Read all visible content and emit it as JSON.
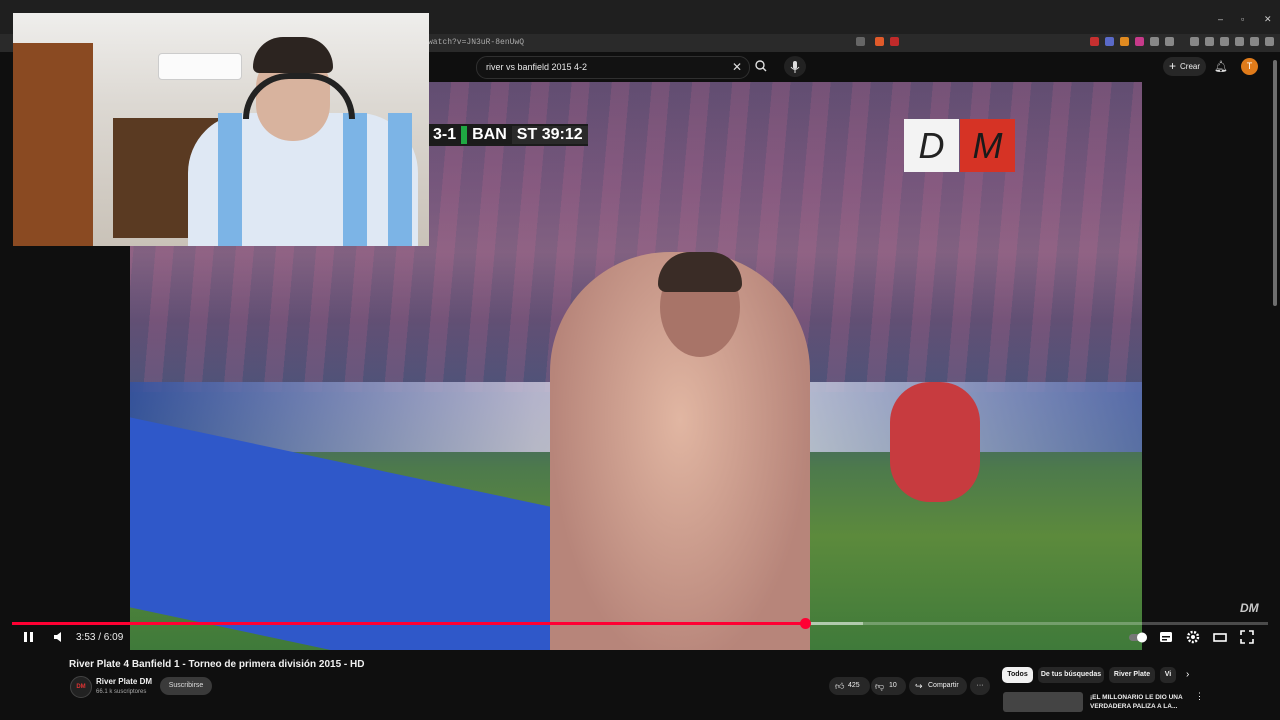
{
  "browser": {
    "url": "watch?v=JN3uR-8enUwQ",
    "window_controls": [
      "–",
      "▫",
      "✕"
    ]
  },
  "youtube_header": {
    "search_query": "river vs banfield 2015 4-2",
    "create_label": "Crear",
    "avatar_letter": "T"
  },
  "video": {
    "scoreboard": {
      "home_score": "3-1",
      "away_team": "BAN",
      "clock": "ST 39:12"
    },
    "logo_letters": [
      "D",
      "M"
    ],
    "watermark": "DM"
  },
  "player_controls": {
    "current_time": "3:53",
    "duration": "6:09",
    "time_display": "3:53 / 6:09",
    "progress_fraction": 0.6314,
    "buffered_fraction": 0.6775
  },
  "video_info": {
    "title": "River Plate 4 Banfield 1 - Torneo de primera división 2015 - HD",
    "channel_name": "River Plate DM",
    "subscribers": "66.1 k suscriptores",
    "subscribe_label": "Suscribirse",
    "likes": "425",
    "dislikes": "10",
    "share_label": "Compartir",
    "more_label": "···"
  },
  "related": {
    "chips": [
      "Todos",
      "De tus búsquedas",
      "River Plate",
      "Vi"
    ],
    "first_video_title": "¡EL MILLONARIO LE DIO UNA VERDADERA PALIZA A LA..."
  },
  "colors": {
    "progress": "#ff0033",
    "avatar": "#e07b1a",
    "background": "#0f0f0f"
  }
}
